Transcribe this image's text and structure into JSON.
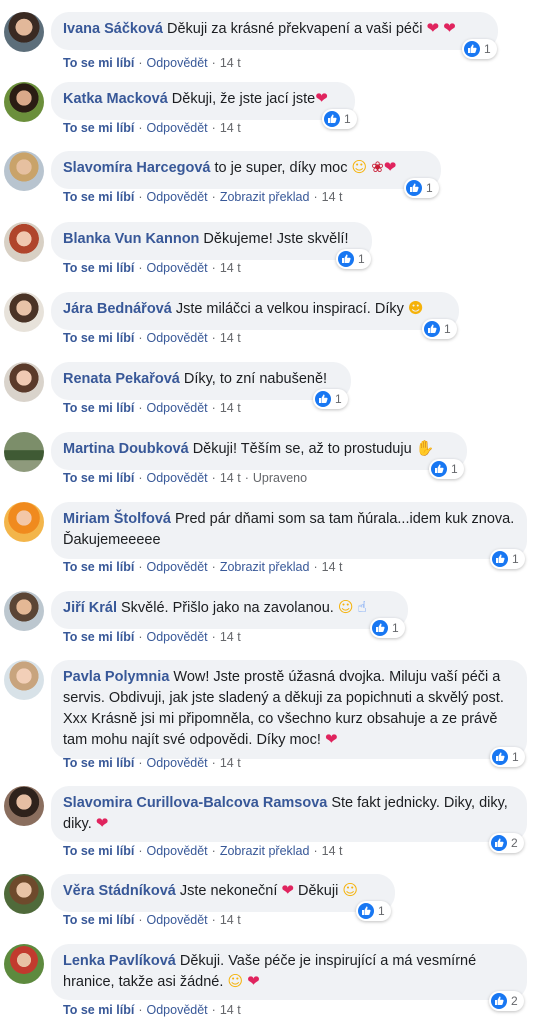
{
  "actions": {
    "like": "To se mi líbí",
    "reply": "Odpovědět",
    "translate": "Zobrazit překlad",
    "edited": "Upraveno",
    "separator": "·"
  },
  "comments": [
    {
      "author": "Ivana Sáčková",
      "text": "Děkuji za krásné překvapení a vaši péči",
      "emoji": [
        "heart",
        "heart"
      ],
      "likes": "1",
      "time": "14 t"
    },
    {
      "author": "Katka Macková",
      "text": "Děkuji, že jste jací jste",
      "emoji": [
        "heart"
      ],
      "likes": "1",
      "time": "14 t"
    },
    {
      "author": "Slavomíra Harcegová",
      "text": "to je super, díky moc",
      "emoji": [
        "smile",
        "rose",
        "heart"
      ],
      "likes": "1",
      "time": "14 t",
      "translate": true
    },
    {
      "author": "Blanka Vun Kannon",
      "text": "Děkujeme! Jste skvělí!",
      "emoji": [],
      "likes": "1",
      "time": "14 t"
    },
    {
      "author": "Jára Bednářová",
      "text": "Jste miláčci a velkou inspirací. Díky",
      "emoji": [
        "wink"
      ],
      "likes": "1",
      "time": "14 t"
    },
    {
      "author": "Renata Pekařová",
      "text": "Díky, to zní nabušeně!",
      "emoji": [],
      "likes": "1",
      "time": "14 t"
    },
    {
      "author": "Martina Doubková",
      "text": "Děkuji! Těším se, až to prostuduju",
      "emoji": [
        "hand"
      ],
      "likes": "1",
      "time": "14 t",
      "edited": true
    },
    {
      "author": "Miriam Štolfová",
      "text": "Pred pár dňami som sa tam ňúrala...idem kuk znova. Ďakujemeeeee",
      "emoji": [],
      "likes": "1",
      "time": "14 t",
      "translate": true
    },
    {
      "author": "Jiří Král",
      "text": "Skvělé. Přišlo jako na zavolanou.",
      "emoji": [
        "smile",
        "thumb"
      ],
      "likes": "1",
      "time": "14 t"
    },
    {
      "author": "Pavla Polymnia",
      "text": "Wow! Jste prostě úžasná dvojka. Miluju vaší péči a servis. Obdivuji, jak jste sladený a děkuji za popichnuti a skvělý post. Xxx Krásně jsi mi připomněla, co všechno kurz obsahuje a ze právě tam mohu najít své odpovědi. Díky moc!",
      "emoji": [
        "heart"
      ],
      "likes": "1",
      "time": "14 t"
    },
    {
      "author": "Slavomira Curillova-Balcova Ramsova",
      "text": "Ste fakt jednicky. Diky, diky, diky.",
      "emoji": [
        "heart"
      ],
      "likes": "2",
      "time": "14 t",
      "translate": true
    },
    {
      "author": "Věra Stádníková",
      "text": "Jste nekoneční",
      "emoji": [
        "heart"
      ],
      "text2": "Děkuji",
      "emoji2": [
        "smile"
      ],
      "likes": "1",
      "time": "14 t"
    },
    {
      "author": "Lenka Pavlíková",
      "text": "Děkuji. Vaše péče je inspirující a má vesmírné hranice, takže asi žádné.",
      "emoji": [
        "smile",
        "heart"
      ],
      "likes": "2",
      "time": "14 t"
    }
  ],
  "colors": {
    "author": "#385898",
    "bubble": "#f0f2f5",
    "like_badge": "#1877f2",
    "meta": "#65676b",
    "heart": "#e0245e"
  }
}
